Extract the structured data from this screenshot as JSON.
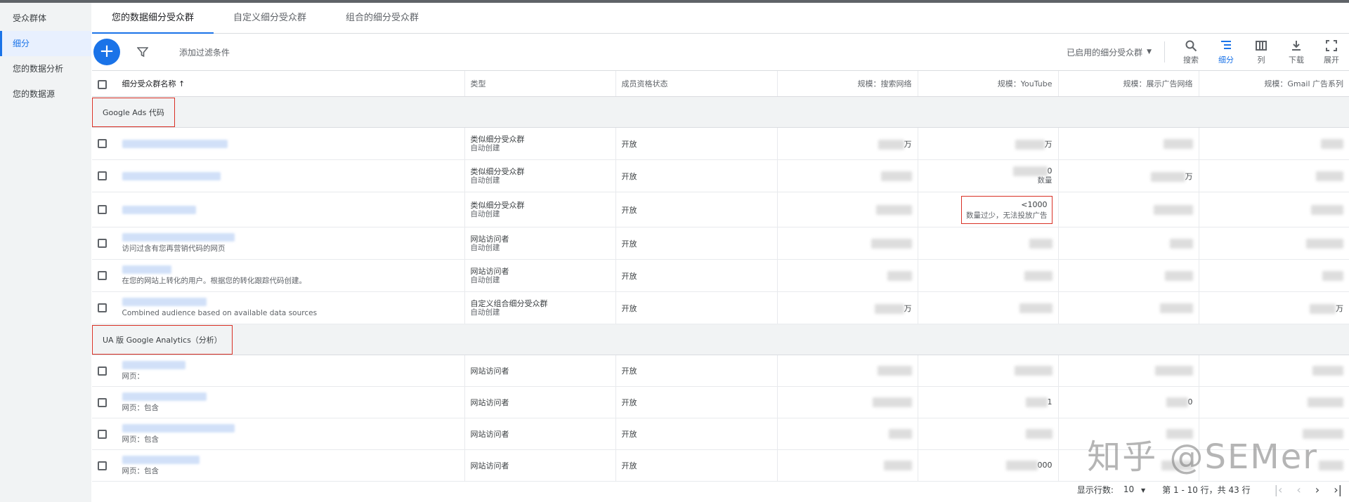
{
  "sidebar": {
    "items": [
      {
        "label": "受众群体"
      },
      {
        "label": "细分"
      },
      {
        "label": "您的数据分析"
      },
      {
        "label": "您的数据源"
      }
    ]
  },
  "tabs": [
    {
      "label": "您的数据细分受众群"
    },
    {
      "label": "自定义细分受众群"
    },
    {
      "label": "组合的细分受众群"
    }
  ],
  "toolbar": {
    "add_filter": "添加过滤条件",
    "enabled_select": "已启用的细分受众群",
    "search": "搜索",
    "segment": "细分",
    "columns": "列",
    "download": "下载",
    "expand": "展开"
  },
  "table": {
    "headers": {
      "name": "细分受众群名称 ↑",
      "type": "类型",
      "status": "成员资格状态",
      "search": "规模：搜索网络",
      "youtube": "规模：YouTube",
      "display": "规模：展示广告网络",
      "gmail": "规模：Gmail 广告系列"
    },
    "groups": [
      {
        "label": "Google Ads 代码",
        "rows": [
          {
            "desc": "",
            "type1": "类似细分受众群",
            "type2": "自动创建",
            "status": "开放",
            "search": "万",
            "youtube": "万",
            "display": "",
            "gmail": "",
            "highlight": false
          },
          {
            "desc": "",
            "type1": "类似细分受众群",
            "type2": "自动创建",
            "status": "开放",
            "search": "",
            "youtube": "0",
            "youtube_note": "数量",
            "display": "万",
            "gmail": "",
            "highlight": false
          },
          {
            "desc": "",
            "type1": "类似细分受众群",
            "type2": "自动创建",
            "status": "开放",
            "search": "",
            "youtube": "<1000",
            "youtube_note": "数量过少，无法投放广告",
            "display": "",
            "gmail": "",
            "highlight": true
          },
          {
            "desc": "访问过含有您再营销代码的网页",
            "type1": "网站访问者",
            "type2": "自动创建",
            "status": "开放",
            "search": "",
            "youtube": "",
            "display": "",
            "gmail": "",
            "highlight": false
          },
          {
            "desc": "在您的网站上转化的用户。根据您的转化跟踪代码创建。",
            "type1": "网站访问者",
            "type2": "自动创建",
            "status": "开放",
            "search": "",
            "youtube": "",
            "display": "",
            "gmail": "",
            "highlight": false
          },
          {
            "desc": "Combined audience based on available data sources",
            "type1": "自定义组合细分受众群",
            "type2": "自动创建",
            "status": "开放",
            "search": "万",
            "youtube": "",
            "display": "",
            "gmail": "万",
            "highlight": false
          }
        ]
      },
      {
        "label": "UA 版 Google Analytics（分析）",
        "rows": [
          {
            "desc": "网页：",
            "type1": "网站访问者",
            "type2": "",
            "status": "开放",
            "search": "",
            "youtube": "",
            "display": "",
            "gmail": "",
            "highlight": false
          },
          {
            "desc": "网页：包含",
            "type1": "网站访问者",
            "type2": "",
            "status": "开放",
            "search": "",
            "youtube": "1",
            "display": "0",
            "gmail": "",
            "highlight": false
          },
          {
            "desc": "网页：包含",
            "type1": "网站访问者",
            "type2": "",
            "status": "开放",
            "search": "",
            "youtube": "",
            "display": "",
            "gmail": "",
            "highlight": false
          },
          {
            "desc": "网页：包含",
            "type1": "网站访问者",
            "type2": "",
            "status": "开放",
            "search": "",
            "youtube": "000",
            "display": "",
            "gmail": "",
            "highlight": false
          }
        ]
      }
    ]
  },
  "footer": {
    "rows_label": "显示行数:",
    "rows_value": "10",
    "range": "第 1 - 10 行，共 43 行"
  },
  "watermark": "知乎 @SEMer"
}
